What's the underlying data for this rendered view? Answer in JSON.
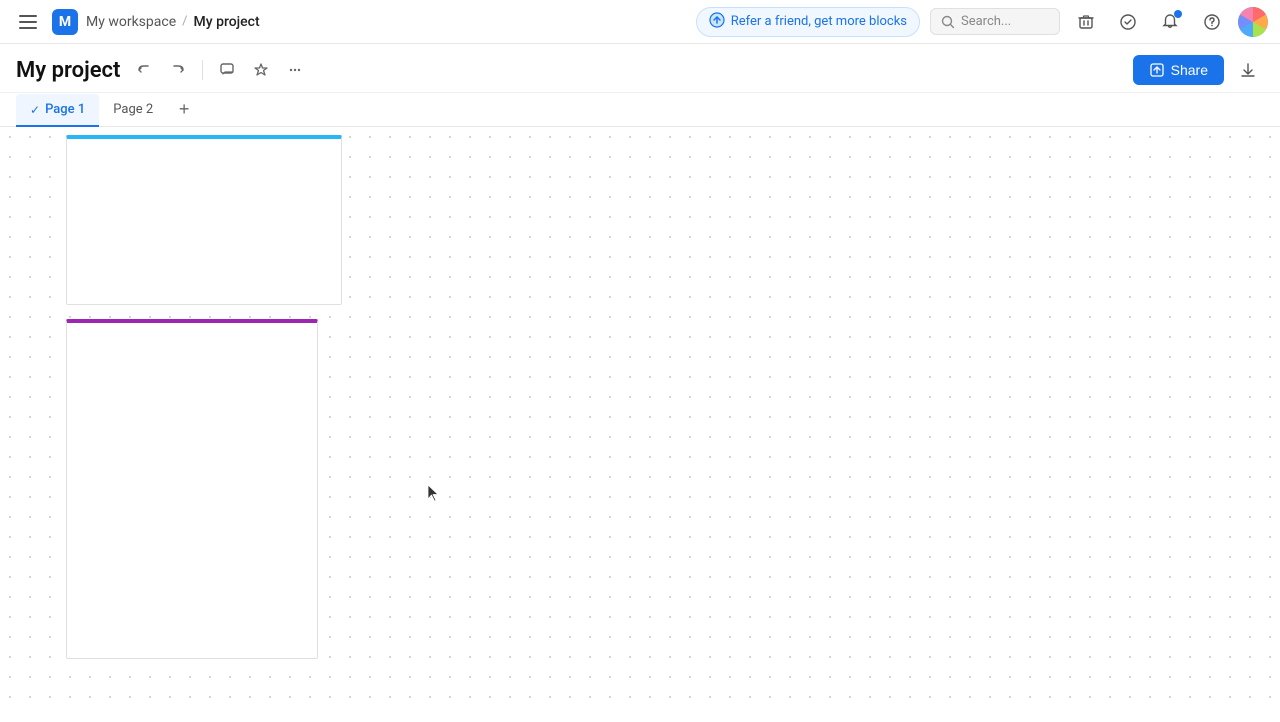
{
  "topnav": {
    "menu_icon": "☰",
    "workspace_logo": "M",
    "workspace_name": "My workspace",
    "breadcrumb_sep": "/",
    "current_page": "My project",
    "refer_icon": "🎁",
    "refer_text": "Refer a friend, get more blocks",
    "search_placeholder": "Search...",
    "icons": {
      "trash": "🗑",
      "check_circle": "✓",
      "bell": "🔔",
      "help": "?"
    }
  },
  "toolbar": {
    "title": "My project",
    "undo_icon": "↩",
    "redo_icon": "↪",
    "comment_icon": "💬",
    "star_icon": "☆",
    "more_icon": "···",
    "share_label": "Share",
    "export_icon": "↑"
  },
  "tabs": [
    {
      "label": "Page 1",
      "active": true
    },
    {
      "label": "Page 2",
      "active": false
    }
  ],
  "tabs_add": "+",
  "canvas": {
    "frame1_color": "#29b6f6",
    "frame2_color": "#9c27b0"
  }
}
